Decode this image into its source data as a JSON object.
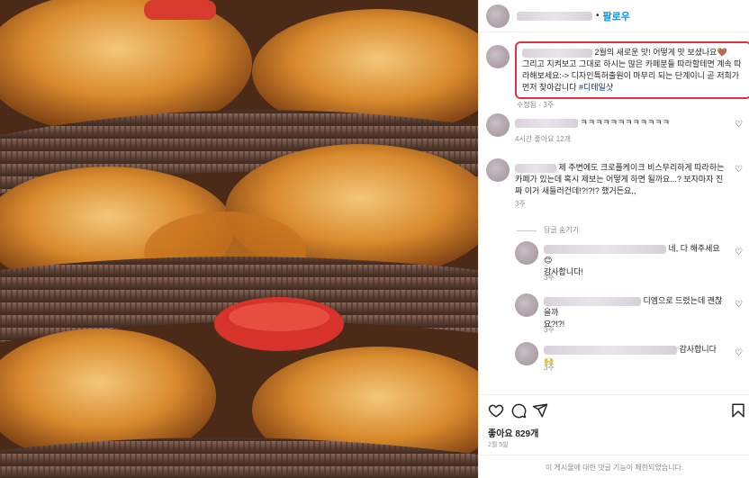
{
  "post": {
    "follow_label": "팔로우",
    "dot": "•"
  },
  "caption": {
    "line1": "2월의 새로운 맛! 어떻게 맛 보셨나요🤎",
    "body": "그리고 지켜보고 그대로 하시는 많은 카페분들 따라할테면 계속 따라해보세요:-> 디자인특허출원이 마무리 되는 단계이니 곧 저희가 먼저 찾아갑니다 ",
    "hashtag": "#디테일샷",
    "meta": "수정됨 · 3주"
  },
  "comments": [
    {
      "text": "ㅋㅋㅋㅋㅋㅋㅋㅋㅋㅋㅋㅋ",
      "meta": "4시간   좋아요 12개"
    },
    {
      "text": "제 주변에도 크로플케이크 비스무리하게 따라하는 카페가 있는데 혹시 제보는 어떻게 하면 될까요...? 보자마자 진짜 이거 새들러건데!?!?!? 했거든요,,",
      "meta": "3주"
    }
  ],
  "reply_toggle": "답글 숨기기",
  "replies": [
    {
      "text_after": "네, 다 해주세요😊",
      "text2": "감사합니다!",
      "meta": "3주"
    },
    {
      "text_after": "디엠으로 드렸는데 괜찮을까",
      "text2": "요?!?!",
      "meta": "3주"
    },
    {
      "text_after": "감사합니다🙌",
      "meta": "3주"
    }
  ],
  "footer": {
    "likes": "좋아요 829개",
    "date": "2월 5일",
    "limited": "이 게시물에 대한 댓글 기능이 제한되었습니다."
  },
  "icons": [
    "heart-icon",
    "comment-icon",
    "share-icon",
    "bookmark-icon"
  ],
  "colors": {
    "accent": "#0095f6",
    "highlight_border": "#e0313f"
  }
}
